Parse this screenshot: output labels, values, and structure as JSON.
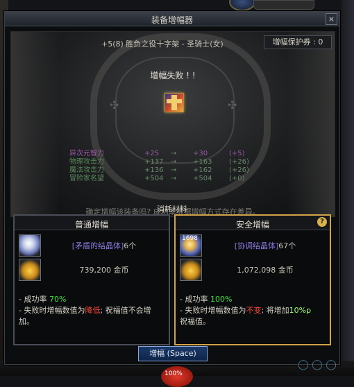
{
  "window": {
    "title": "装备增幅器",
    "close_label": "×"
  },
  "item": {
    "name": "+5(8) 胜负之役十字架 - 圣骑士(女)",
    "protect_ticket": "增幅保护券 : 0",
    "result_message": "增幅失败 ! !"
  },
  "stats": [
    {
      "name": "异次元智力",
      "base": "+25",
      "arrow": "→",
      "new": "+30",
      "diff": "(+5)"
    },
    {
      "name": "物理攻击力",
      "base": "+137",
      "arrow": "→",
      "new": "+163",
      "diff": "(+26)"
    },
    {
      "name": "魔法攻击力",
      "base": "+136",
      "arrow": "→",
      "new": "+162",
      "diff": "(+26)"
    },
    {
      "name": "冒险家名望",
      "base": "+504",
      "arrow": "→",
      "new": "+504",
      "diff": "(+0)"
    }
  ],
  "confirm_text": "确定增幅该装备吗? 成功率根据增幅方式存在差异。",
  "materials_title": "消耗材料",
  "panels": {
    "normal": {
      "title": "普通增幅",
      "material_prefix": "[矛盾的结晶体]",
      "material_count": "6个",
      "gold": "739,200 金币",
      "rate_label": "- 成功率",
      "rate_value": "70%",
      "fail_prefix": "- 失败时增幅数值为",
      "fail_key": "降低",
      "fail_suffix": "; 祝福值不会增加。"
    },
    "safe": {
      "title": "安全增幅",
      "help_label": "?",
      "material_qty": "1698",
      "material_prefix": "[协调结晶体]",
      "material_count": "67个",
      "gold": "1,072,098 金币",
      "rate_label": "- 成功率",
      "rate_value": "100%",
      "fail_prefix": "- 失败时增幅数值为",
      "fail_key": "不变",
      "fail_mid": "; 将增加",
      "fail_bonus": "10%p",
      "fail_suffix": "祝福值。"
    }
  },
  "enhance_button": "增幅 (Space)",
  "hud": {
    "hp_percent": "100%"
  },
  "colors": {
    "safe_border": "#d2a24a",
    "success_green": "#3ee03e",
    "warning_red": "#ff4a3a"
  }
}
